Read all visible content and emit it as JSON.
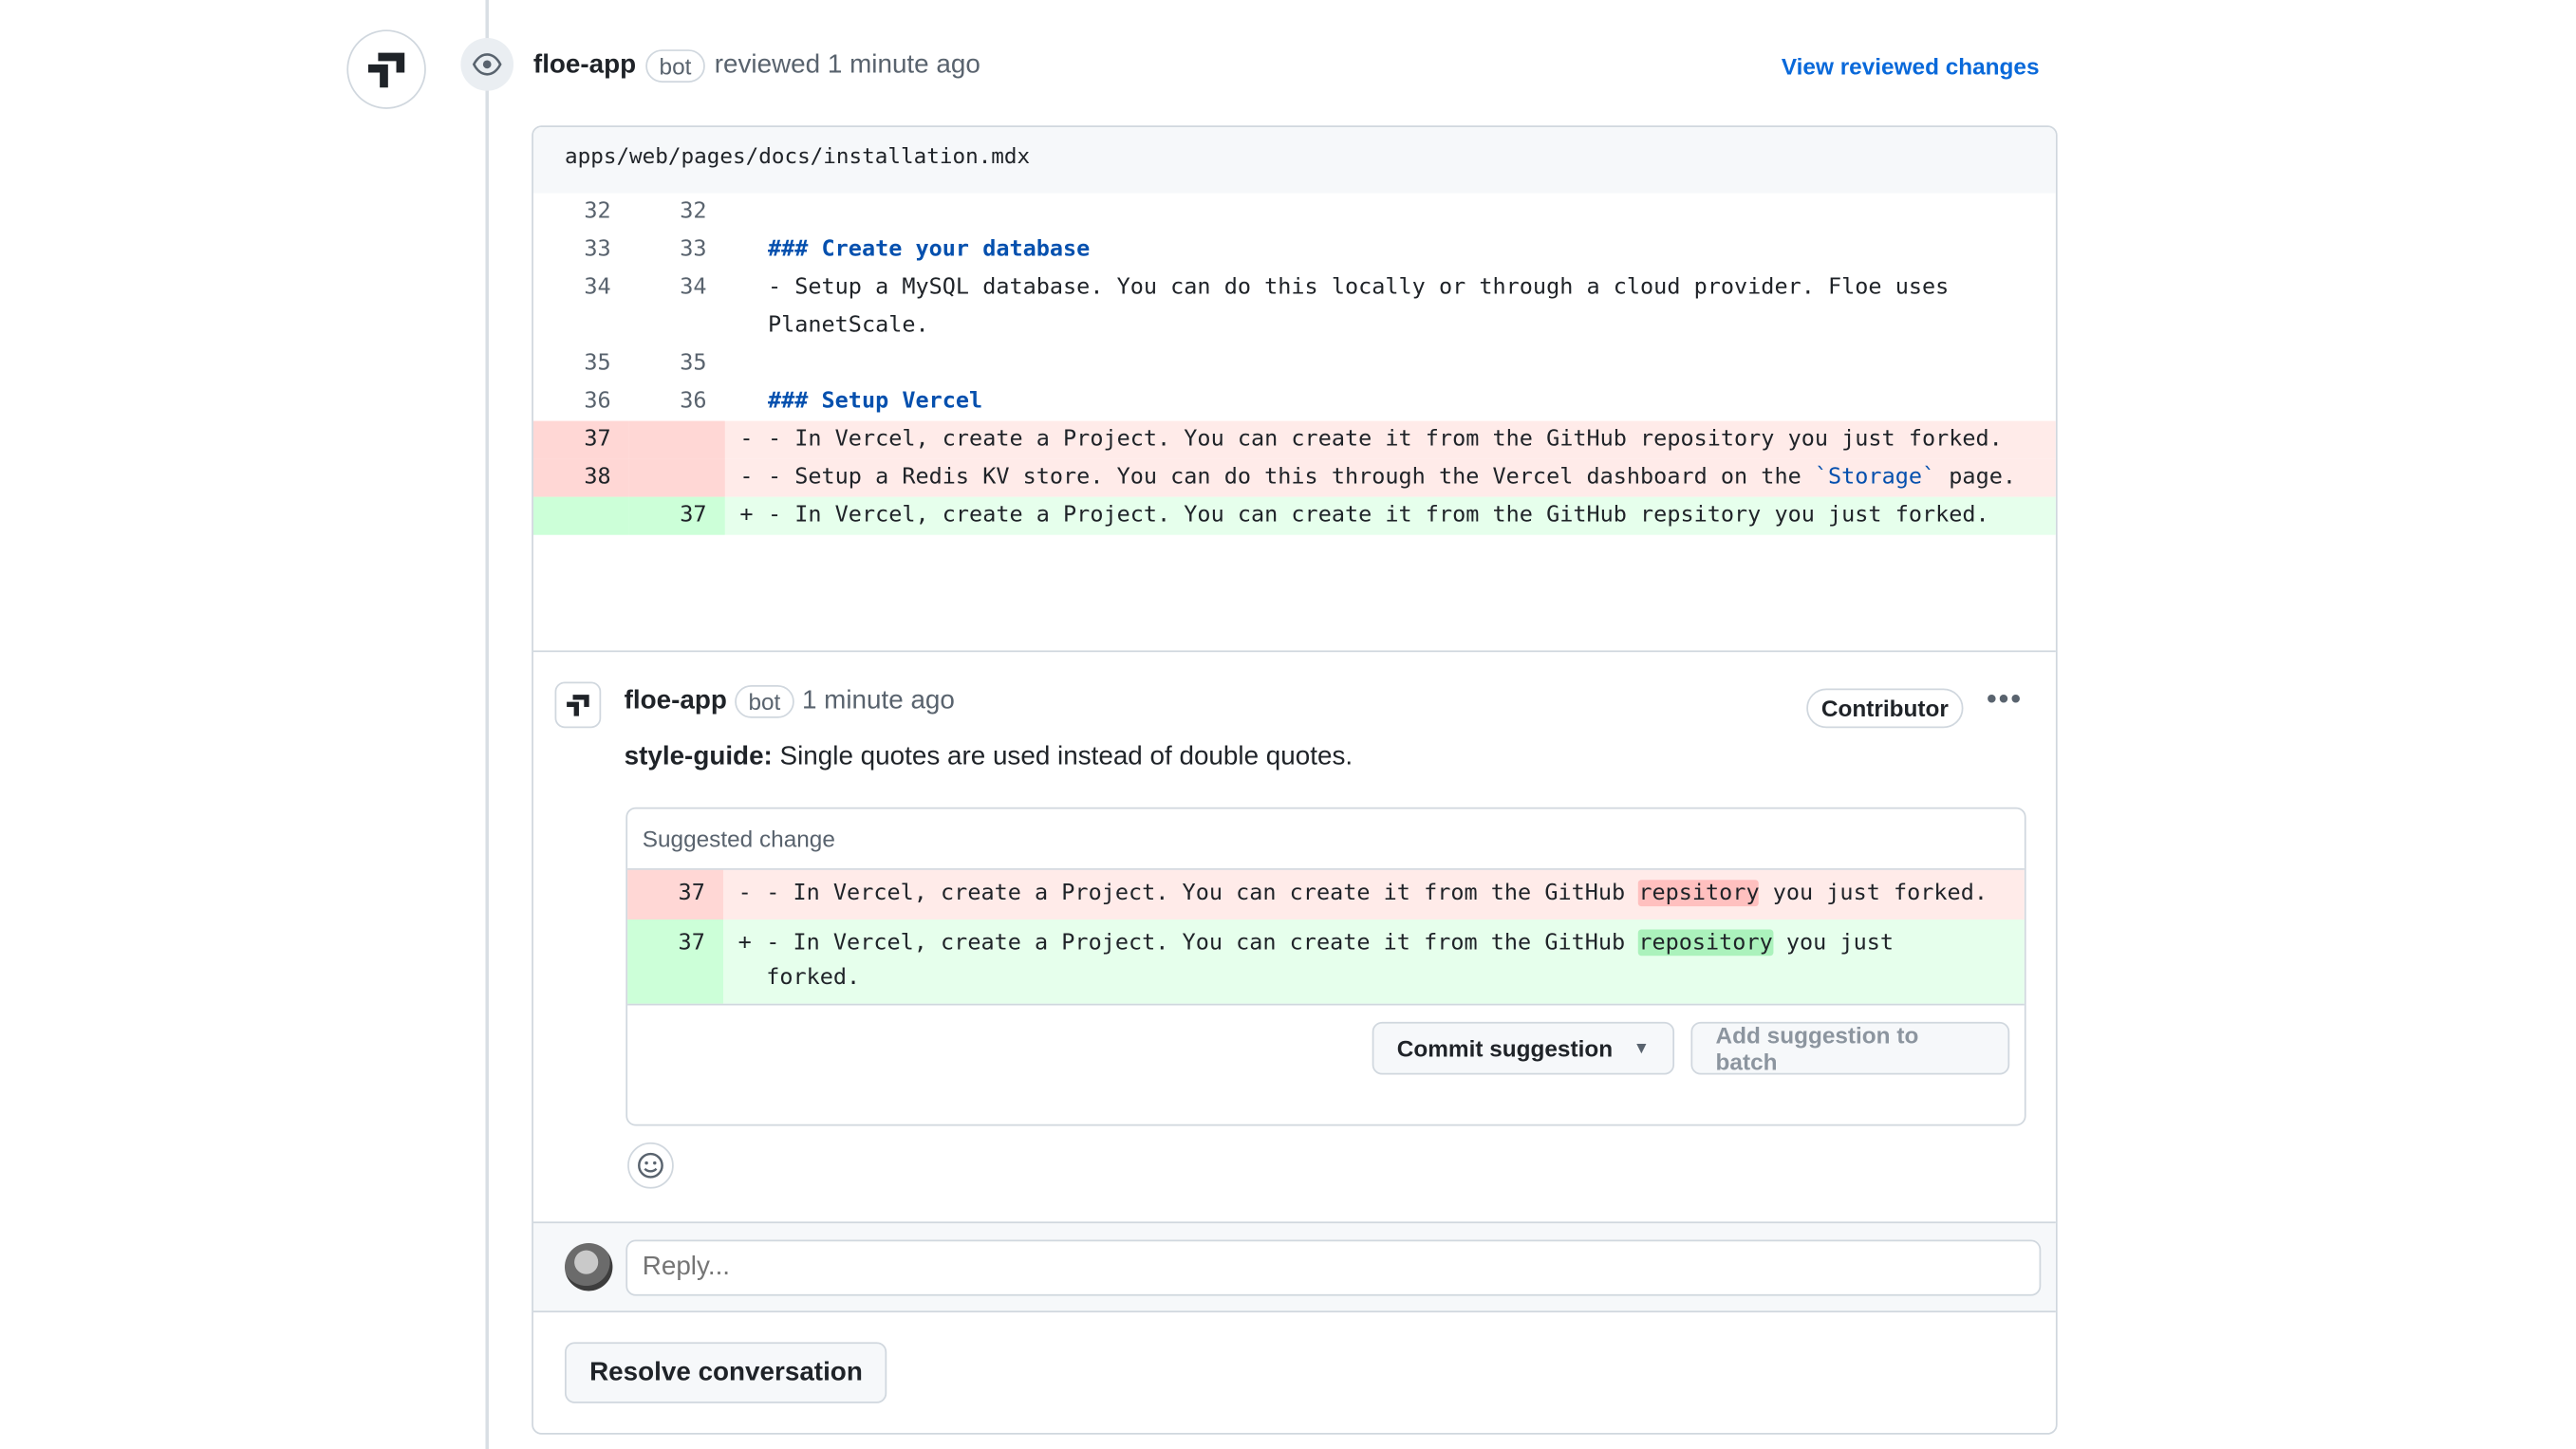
{
  "review": {
    "author": "floe-app",
    "badge": "bot",
    "action": "reviewed 1 minute ago",
    "view_link": "View reviewed changes"
  },
  "file": {
    "path": "apps/web/pages/docs/installation.mdx"
  },
  "diff": [
    {
      "old": "32",
      "new": "32",
      "mark": "",
      "text": "",
      "type": "ctx"
    },
    {
      "old": "33",
      "new": "33",
      "mark": "",
      "text": "### Create your database",
      "type": "ctx",
      "kw": true
    },
    {
      "old": "34",
      "new": "34",
      "mark": "",
      "text": "- Setup a MySQL database. You can do this locally or through a cloud provider. Floe uses PlanetScale.",
      "type": "ctx"
    },
    {
      "old": "35",
      "new": "35",
      "mark": "",
      "text": "",
      "type": "ctx"
    },
    {
      "old": "36",
      "new": "36",
      "mark": "",
      "text": "### Setup Vercel",
      "type": "ctx",
      "kw": true
    },
    {
      "old": "37",
      "new": "",
      "mark": "-",
      "text": "- In Vercel, create a Project. You can create it from the GitHub repository you just forked.",
      "type": "del"
    },
    {
      "old": "38",
      "new": "",
      "mark": "-",
      "text_before": "- Setup a Redis KV store. You can do this through the Vercel dashboard on the ",
      "text_str": "`Storage`",
      "text_after": " page.",
      "type": "del"
    },
    {
      "old": "",
      "new": "37",
      "mark": "+",
      "text": "- In Vercel, create a Project. You can create it from the GitHub repsitory you just forked.",
      "type": "add"
    }
  ],
  "comment": {
    "author": "floe-app",
    "badge": "bot",
    "time": "1 minute ago",
    "role": "Contributor",
    "more": "•••",
    "label": "style-guide:",
    "body": " Single quotes are used instead of double quotes."
  },
  "suggestion": {
    "title": "Suggested change",
    "del": {
      "line": "37",
      "mark": "-",
      "before": "- In Vercel, create a Project. You can create it from the GitHub ",
      "word": "repsitory",
      "after": " you just forked."
    },
    "add": {
      "line": "37",
      "mark": "+",
      "before": "- In Vercel, create a Project. You can create it from the GitHub ",
      "word": "repository",
      "after": " you just forked."
    },
    "commit_label": "Commit suggestion",
    "batch_label": "Add suggestion to batch"
  },
  "reply": {
    "placeholder": "Reply..."
  },
  "resolve_label": "Resolve conversation"
}
